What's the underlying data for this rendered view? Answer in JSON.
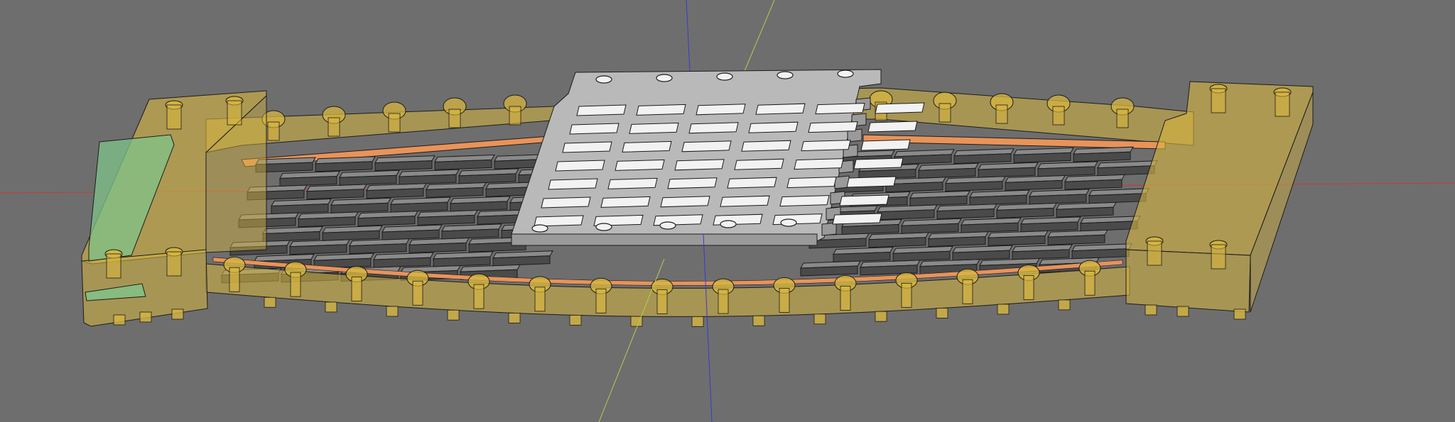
{
  "viewport": {
    "background": "#6e6e6e"
  },
  "axes": {
    "x_color": "#c83a3a",
    "y_color": "#b9c94a",
    "z_color": "#3a3ad0"
  },
  "colors": {
    "frame_fill": "#d7b640",
    "frame_fill_opacity": 0.55,
    "frame_stroke": "#4a3a10",
    "copper_strip": "#e8935a",
    "green_insert": "#7fc48a",
    "block_top": "#8a8a8a",
    "block_face": "#4a4a4a",
    "plate_top": "#b9b9b9",
    "plate_side": "#9a9a9a",
    "slot": "#f2f2f2",
    "edge": "#1c1c1c"
  },
  "scene": {
    "object": "curved-magnet-array-assembly",
    "left_end_cap": "translucent-yellow-end-block",
    "right_end_cap": "translucent-yellow-end-block",
    "center_part": "grey-slotted-pole-plate",
    "side_parts": "grey-magnet-block-arrays"
  }
}
